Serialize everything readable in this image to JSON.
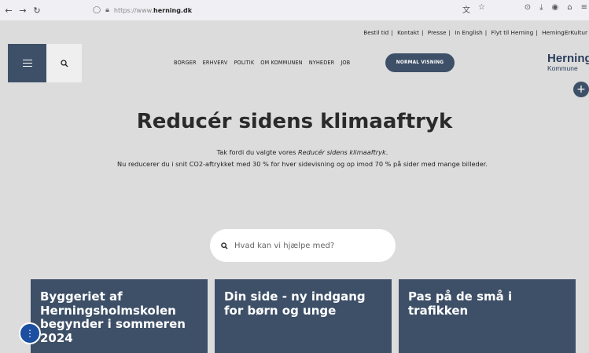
{
  "browser": {
    "url_prefix": "https://www.",
    "url_domain": "herning.dk",
    "nav_back": "←",
    "nav_forward": "→",
    "nav_reload": "↻"
  },
  "toplinks": [
    "Bestil tid",
    "Kontakt",
    "Presse",
    "In English",
    "Flyt til Herning",
    "HerningErKultur"
  ],
  "mainnav": [
    "BORGER",
    "ERHVERV",
    "POLITIK",
    "OM KOMMUNEN",
    "NYHEDER",
    "JOB"
  ],
  "view_button": "NORMAL VISNING",
  "logo": {
    "line1": "Herning",
    "line2": "Kommune"
  },
  "hero": {
    "title": "Reducér sidens klimaaftryk",
    "line1_prefix": "Tak fordi du valgte vores ",
    "line1_em": "Reducér sidens klimaaftryk",
    "line1_suffix": ".",
    "line2": "Nu reducerer du i snit CO2-aftrykket med 30 % for hver sidevisning og op imod 70 % på sider med mange billeder."
  },
  "search": {
    "placeholder": "Hvad kan vi hjælpe med?"
  },
  "cards": [
    {
      "title": "Byggeriet af Herningsholmskolen begynder i sommeren 2024"
    },
    {
      "title": "Din side - ny indgang for børn og unge"
    },
    {
      "title": "Pas på de små i trafikken"
    }
  ]
}
